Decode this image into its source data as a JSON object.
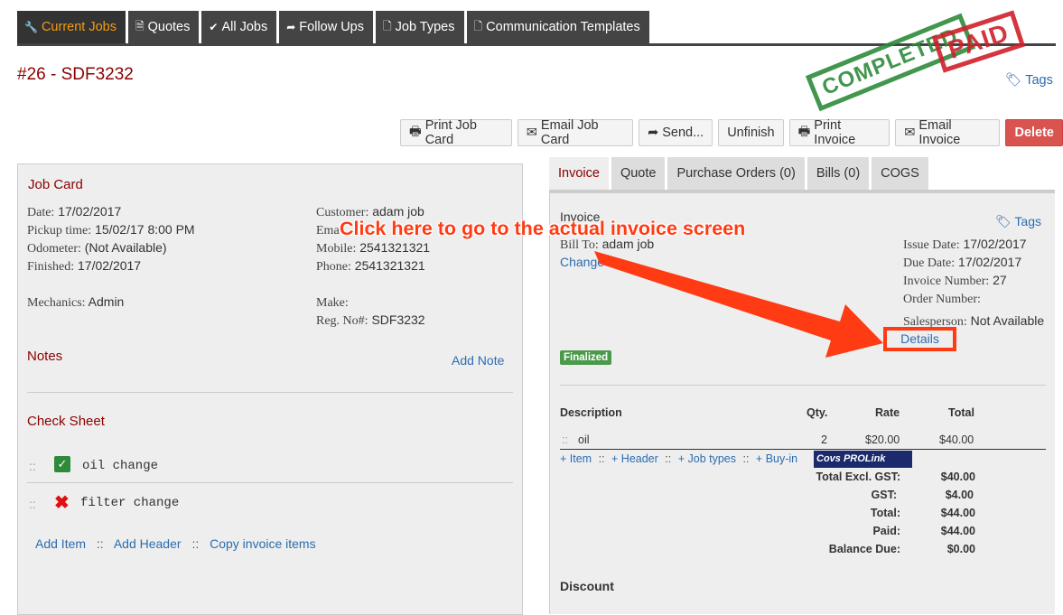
{
  "nav": {
    "tabs": [
      {
        "label": "Current Jobs",
        "icon": "wrench-icon"
      },
      {
        "label": "Quotes",
        "icon": "document-icon"
      },
      {
        "label": "All Jobs",
        "icon": "check-icon"
      },
      {
        "label": "Follow Ups",
        "icon": "share-arrow-icon"
      },
      {
        "label": "Job Types",
        "icon": "file-icon"
      },
      {
        "label": "Communication Templates",
        "icon": "file-icon"
      }
    ]
  },
  "page": {
    "title": "#26 - SDF3232",
    "tags_label": "Tags"
  },
  "stamps": {
    "completed": "COMPLETED",
    "paid": "PAID"
  },
  "actions": {
    "print_job_card": "Print Job Card",
    "email_job_card": "Email Job Card",
    "send": "Send...",
    "unfinish": "Unfinish",
    "print_invoice": "Print Invoice",
    "email_invoice": "Email Invoice",
    "delete": "Delete"
  },
  "job_card": {
    "heading": "Job Card",
    "date_label": "Date:",
    "date": "17/02/2017",
    "pickup_label": "Pickup time:",
    "pickup": "15/02/17 8:00 PM",
    "odometer_label": "Odometer:",
    "odometer": "(Not Available)",
    "finished_label": "Finished:",
    "finished": "17/02/2017",
    "mechanics_label": "Mechanics:",
    "mechanics": "Admin",
    "customer_label": "Customer:",
    "customer": "adam job",
    "email_label": "Ema",
    "mobile_label": "Mobile:",
    "mobile": "2541321321",
    "phone_label": "Phone:",
    "phone": "2541321321",
    "make_label": "Make:",
    "rego_label": "Reg. No#:",
    "rego": "SDF3232",
    "notes_heading": "Notes",
    "add_note": "Add Note",
    "check_heading": "Check Sheet",
    "check_items": [
      {
        "label": "oil change",
        "status": "checked"
      },
      {
        "label": "filter change",
        "status": "failed"
      }
    ],
    "add_item": "Add Item",
    "add_header": "Add Header",
    "copy_items": "Copy invoice items"
  },
  "invoice_tabs": [
    "Invoice",
    "Quote",
    "Purchase Orders (0)",
    "Bills (0)",
    "COGS"
  ],
  "invoice": {
    "heading": "Invoice",
    "tags_label": "Tags",
    "bill_to_label": "Bill To:",
    "bill_to": "adam job",
    "change_label": "Change",
    "issue_date_label": "Issue Date:",
    "issue_date": "17/02/2017",
    "due_date_label": "Due Date:",
    "due_date": "17/02/2017",
    "invoice_number_label": "Invoice Number:",
    "invoice_number": "27",
    "order_number_label": "Order Number:",
    "salesperson_label": "Salesperson:",
    "salesperson": "Not Available",
    "details_label": "Details",
    "status_badge": "Finalized",
    "columns": {
      "description": "Description",
      "qty": "Qty.",
      "rate": "Rate",
      "total": "Total"
    },
    "line_items": [
      {
        "description": "oil",
        "qty": "2",
        "rate": "$20.00",
        "total": "$40.00"
      }
    ],
    "add_item": "+ Item",
    "add_header": "+ Header",
    "add_job_types": "+ Job types",
    "add_buyin": "+ Buy-in",
    "supplier_logo": "Covs PROLink",
    "totals": [
      {
        "label": "Total Excl. GST:",
        "value": "$40.00"
      },
      {
        "label": "GST:",
        "value": "$4.00"
      },
      {
        "label": "Total:",
        "value": "$44.00"
      },
      {
        "label": "Paid:",
        "value": "$44.00"
      },
      {
        "label": "Balance Due:",
        "value": "$0.00"
      }
    ],
    "discount_heading": "Discount"
  },
  "annotation": {
    "callout_text": "Click here to go to the actual invoice screen",
    "color": "#ff3b14"
  },
  "colors": {
    "nav_bg": "#444444",
    "nav_active_text": "#f39c12",
    "title": "#8b0000",
    "link": "#2a6db0",
    "danger": "#d9534f",
    "stamp_green": "#2e8b3a",
    "stamp_red": "#d0202a"
  }
}
